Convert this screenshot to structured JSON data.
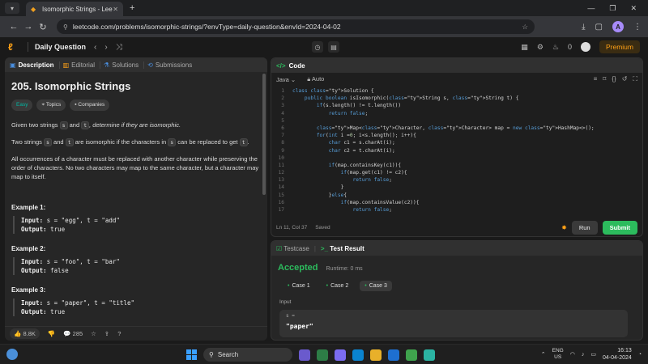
{
  "browser": {
    "tab_title": "Isomorphic Strings - LeetCode",
    "url": "leetcode.com/problems/isomorphic-strings/?envType=daily-question&envId=2024-04-02",
    "profile_initial": "A"
  },
  "header": {
    "daily_label": "Daily Question",
    "streak_count": "0",
    "premium_label": "Premium"
  },
  "left_tabs": [
    "Description",
    "Editorial",
    "Solutions",
    "Submissions"
  ],
  "problem": {
    "title": "205. Isomorphic Strings",
    "badges": [
      "Easy",
      "Topics",
      "Companies"
    ],
    "p1_pre": "Given two strings ",
    "p1_s": "s",
    "p1_and": " and ",
    "p1_t": "t",
    "p1_post": ", determine if they are isomorphic.",
    "p2_pre": "Two strings ",
    "p2_s": "s",
    "p2_and": " and ",
    "p2_t": "t",
    "p2_mid": " are isomorphic if the characters in ",
    "p2_s2": "s",
    "p2_mid2": " can be replaced to get ",
    "p2_t2": "t",
    "p2_end": ".",
    "p3": "All occurrences of a character must be replaced with another character while preserving the order of characters. No two characters may map to the same character, but a character may map to itself.",
    "examples": [
      {
        "title": "Example 1:",
        "input_label": "Input:",
        "input": "s = \"egg\", t = \"add\"",
        "output_label": "Output:",
        "output": "true"
      },
      {
        "title": "Example 2:",
        "input_label": "Input:",
        "input": "s = \"foo\", t = \"bar\"",
        "output_label": "Output:",
        "output": "false"
      },
      {
        "title": "Example 3:",
        "input_label": "Input:",
        "input": "s = \"paper\", t = \"title\"",
        "output_label": "Output:",
        "output": "true"
      }
    ]
  },
  "left_footer": {
    "likes": "8.8K",
    "comments": "285"
  },
  "code_panel": {
    "title": "Code",
    "language": "Java",
    "mode": "Auto",
    "cursor_pos": "Ln 11, Col 37",
    "saved_label": "Saved",
    "run_label": "Run",
    "submit_label": "Submit"
  },
  "code_lines": [
    "class Solution {",
    "    public boolean isIsomorphic(String s, String t) {",
    "        if(s.length() != t.length())",
    "            return false;",
    "",
    "        Map<Character, Character> map = new HashMap<>();",
    "        for(int i =0; i<s.length(); i++){",
    "            char c1 = s.charAt(i);",
    "            char c2 = t.charAt(i);",
    "",
    "            if(map.containsKey(c1)){",
    "                if(map.get(c1) != c2){",
    "                    return false;",
    "                }",
    "            }else{",
    "                if(map.containsValue(c2)){",
    "                    return false;"
  ],
  "test_panel": {
    "tab_testcase": "Testcase",
    "tab_result": "Test Result",
    "status": "Accepted",
    "runtime": "Runtime: 0 ms",
    "cases": [
      "Case 1",
      "Case 2",
      "Case 3"
    ],
    "input_label": "Input",
    "var_name": "s =",
    "var_value": "\"paper\""
  },
  "taskbar": {
    "search_label": "Search",
    "lang_line1": "ENG",
    "lang_line2": "US",
    "time": "16:13",
    "date": "04-04-2024"
  },
  "colors": {
    "accent_orange": "#ffa116",
    "accepted_green": "#2cbb5d",
    "easy_teal": "#00b8a3"
  }
}
